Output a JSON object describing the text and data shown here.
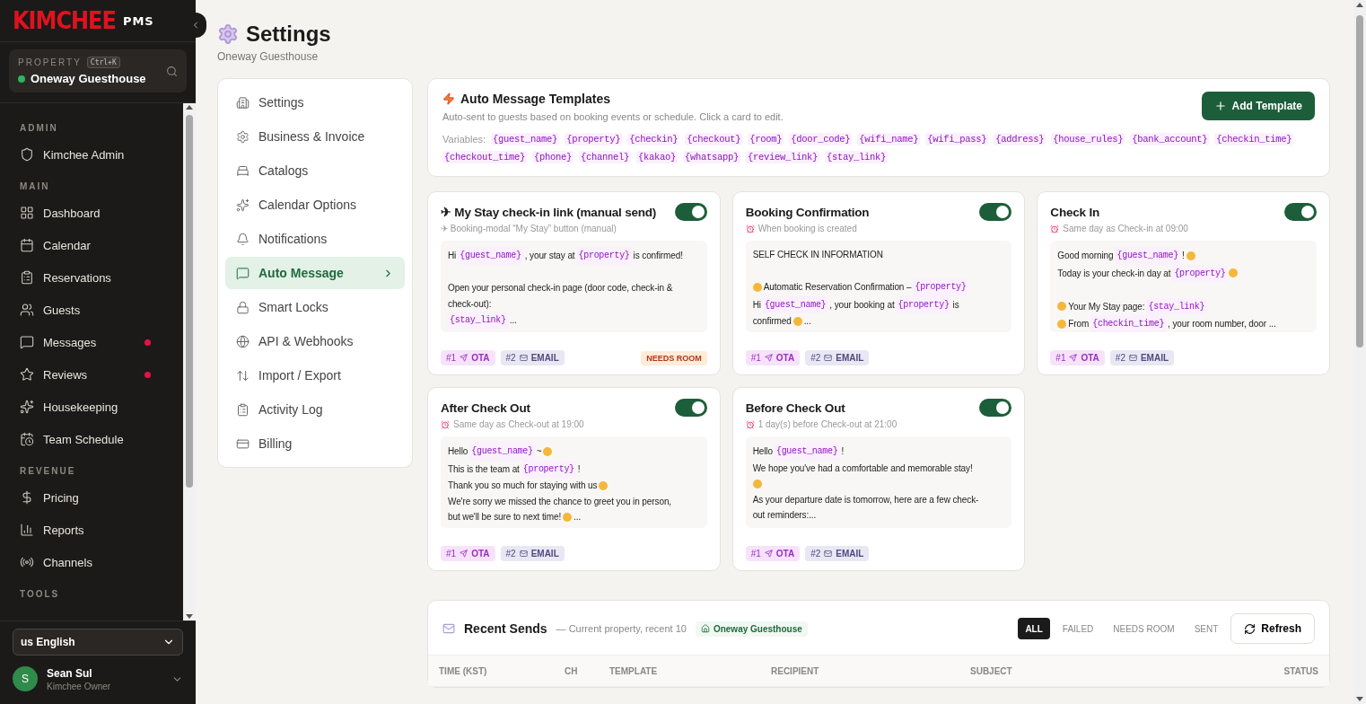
{
  "brand": {
    "name": "KIMCHEE",
    "suffix": "PMS"
  },
  "property": {
    "label": "PROPERTY",
    "shortcut": "Ctrl+K",
    "name": "Oneway Guesthouse",
    "online": true
  },
  "sidebar": {
    "sections": [
      {
        "title": "ADMIN",
        "items": [
          {
            "label": "Kimchee Admin",
            "alert": false
          }
        ]
      },
      {
        "title": "MAIN",
        "items": [
          {
            "label": "Dashboard",
            "alert": false
          },
          {
            "label": "Calendar",
            "alert": false
          },
          {
            "label": "Reservations",
            "alert": false
          },
          {
            "label": "Guests",
            "alert": false
          },
          {
            "label": "Messages",
            "alert": true
          },
          {
            "label": "Reviews",
            "alert": true
          },
          {
            "label": "Housekeeping",
            "alert": false
          },
          {
            "label": "Team Schedule",
            "alert": false
          }
        ]
      },
      {
        "title": "REVENUE",
        "items": [
          {
            "label": "Pricing",
            "alert": false
          },
          {
            "label": "Reports",
            "alert": false
          },
          {
            "label": "Channels",
            "alert": false
          }
        ]
      },
      {
        "title": "TOOLS"
      }
    ]
  },
  "language": {
    "value": "us English"
  },
  "user": {
    "initial": "S",
    "name": "Sean Sul",
    "role": "Kimchee Owner"
  },
  "page": {
    "title": "Settings",
    "subtitle": "Oneway Guesthouse"
  },
  "settings_nav": [
    {
      "label": "Settings",
      "selected": false
    },
    {
      "label": "Business & Invoice",
      "selected": false
    },
    {
      "label": "Catalogs",
      "selected": false
    },
    {
      "label": "Calendar Options",
      "selected": false
    },
    {
      "label": "Notifications",
      "selected": false
    },
    {
      "label": "Auto Message",
      "selected": true
    },
    {
      "label": "Smart Locks",
      "selected": false
    },
    {
      "label": "API & Webhooks",
      "selected": false
    },
    {
      "label": "Import / Export",
      "selected": false
    },
    {
      "label": "Activity Log",
      "selected": false
    },
    {
      "label": "Billing",
      "selected": false
    }
  ],
  "templates_header": {
    "title": "Auto Message Templates",
    "description": "Auto-sent to guests based on booking events or schedule. Click a card to edit.",
    "add_button": "Add Template",
    "variables_label": "Variables:",
    "variables": [
      "{guest_name}",
      "{property}",
      "{checkin}",
      "{checkout}",
      "{room}",
      "{door_code}",
      "{wifi_name}",
      "{wifi_pass}",
      "{address}",
      "{house_rules}",
      "{bank_account}",
      "{checkin_time}",
      "{checkout_time}",
      "{phone}",
      "{channel}",
      "{kakao}",
      "{whatsapp}",
      "{review_link}",
      "{stay_link}"
    ]
  },
  "templates": [
    {
      "title": "✈ My Stay check-in link (manual send)",
      "on": true,
      "trigger": {
        "kind": "manual",
        "text": "✈ Booking-modal “My Stay” button (manual)"
      },
      "body": [
        {
          "lines": [
            [
              {
                "kind": "text",
                "text": "Hi"
              },
              {
                "kind": "var",
                "text": "{guest_name}"
              },
              {
                "kind": "text",
                "text": ", your stay at"
              },
              {
                "kind": "var",
                "text": "{property}"
              },
              {
                "kind": "text",
                "text": "is confirmed!"
              }
            ]
          ]
        },
        {
          "lines": [
            [
              {
                "kind": "text",
                "text": "Open your personal check-in page (door code, check-in &"
              }
            ],
            [
              {
                "kind": "text",
                "text": "check-out):"
              }
            ],
            [
              {
                "kind": "var",
                "text": "{stay_link}"
              },
              {
                "kind": "text",
                "text": "..."
              }
            ]
          ]
        }
      ],
      "channels": [
        {
          "order": "#1",
          "name": "OTA",
          "kind": "ota"
        },
        {
          "order": "#2",
          "name": "EMAIL",
          "kind": "email"
        }
      ],
      "badge": "NEEDS ROOM"
    },
    {
      "title": "Booking Confirmation",
      "on": true,
      "trigger": {
        "kind": "schedule",
        "text": "When booking is created"
      },
      "body": [
        {
          "lines": [
            [
              {
                "kind": "text",
                "text": "SELF CHECK IN INFORMATION"
              }
            ]
          ]
        },
        {
          "lines": [
            [
              {
                "kind": "emoji"
              },
              {
                "kind": "text",
                "text": "Automatic Reservation Confirmation –"
              },
              {
                "kind": "var",
                "text": "{property}"
              }
            ],
            [
              {
                "kind": "text",
                "text": "Hi"
              },
              {
                "kind": "var",
                "text": "{guest_name}"
              },
              {
                "kind": "text",
                "text": ", your booking at"
              },
              {
                "kind": "var",
                "text": "{property}"
              },
              {
                "kind": "text",
                "text": "is"
              }
            ],
            [
              {
                "kind": "text",
                "text": "confirmed"
              },
              {
                "kind": "emoji"
              },
              {
                "kind": "text",
                "text": "..."
              }
            ]
          ]
        }
      ],
      "channels": [
        {
          "order": "#1",
          "name": "OTA",
          "kind": "ota"
        },
        {
          "order": "#2",
          "name": "EMAIL",
          "kind": "email"
        }
      ]
    },
    {
      "title": "Check In",
      "on": true,
      "trigger": {
        "kind": "schedule",
        "text": "Same day as Check-in at 09:00"
      },
      "body": [
        {
          "lines": [
            [
              {
                "kind": "text",
                "text": "Good morning"
              },
              {
                "kind": "var",
                "text": "{guest_name}"
              },
              {
                "kind": "text",
                "text": "!"
              },
              {
                "kind": "emoji"
              }
            ],
            [
              {
                "kind": "text",
                "text": "Today is your check-in day at"
              },
              {
                "kind": "var",
                "text": "{property}"
              },
              {
                "kind": "emoji"
              }
            ]
          ]
        },
        {
          "lines": [
            [
              {
                "kind": "emoji"
              },
              {
                "kind": "text",
                "text": "Your My Stay page:"
              },
              {
                "kind": "var",
                "text": "{stay_link}"
              }
            ],
            [
              {
                "kind": "emoji"
              },
              {
                "kind": "text",
                "text": "From"
              },
              {
                "kind": "var",
                "text": "{checkin_time}"
              },
              {
                "kind": "text",
                "text": ", your room number, door ..."
              }
            ]
          ]
        }
      ],
      "channels": [
        {
          "order": "#1",
          "name": "OTA",
          "kind": "ota"
        },
        {
          "order": "#2",
          "name": "EMAIL",
          "kind": "email"
        }
      ]
    },
    {
      "title": "After Check Out",
      "on": true,
      "trigger": {
        "kind": "schedule",
        "text": "Same day as Check-out at 19:00"
      },
      "body": [
        {
          "lines": [
            [
              {
                "kind": "text",
                "text": "Hello"
              },
              {
                "kind": "var",
                "text": "{guest_name}"
              },
              {
                "kind": "text",
                "text": "~"
              },
              {
                "kind": "emoji"
              }
            ],
            [
              {
                "kind": "text",
                "text": "This is the team at"
              },
              {
                "kind": "var",
                "text": "{property}"
              },
              {
                "kind": "text",
                "text": "!"
              }
            ],
            [
              {
                "kind": "text",
                "text": "Thank you so much for staying with us"
              },
              {
                "kind": "emoji"
              }
            ],
            [
              {
                "kind": "text",
                "text": "We're sorry we missed the chance to greet you in person,"
              }
            ],
            [
              {
                "kind": "text",
                "text": "but we'll be sure to next time!"
              },
              {
                "kind": "emoji"
              },
              {
                "kind": "text",
                "text": "..."
              }
            ]
          ]
        }
      ],
      "channels": [
        {
          "order": "#1",
          "name": "OTA",
          "kind": "ota"
        },
        {
          "order": "#2",
          "name": "EMAIL",
          "kind": "email"
        }
      ]
    },
    {
      "title": "Before Check Out",
      "on": true,
      "trigger": {
        "kind": "schedule",
        "text": "1 day(s) before Check-out at 21:00"
      },
      "body": [
        {
          "lines": [
            [
              {
                "kind": "text",
                "text": "Hello"
              },
              {
                "kind": "var",
                "text": "{guest_name}"
              },
              {
                "kind": "text",
                "text": "!"
              }
            ],
            [
              {
                "kind": "text",
                "text": "We hope you've had a comfortable and memorable stay!"
              }
            ],
            [
              {
                "kind": "emoji"
              }
            ],
            [
              {
                "kind": "text",
                "text": "As your departure date is tomorrow, here are a few check-"
              }
            ],
            [
              {
                "kind": "text",
                "text": "out reminders:..."
              }
            ]
          ]
        }
      ],
      "channels": [
        {
          "order": "#1",
          "name": "OTA",
          "kind": "ota"
        },
        {
          "order": "#2",
          "name": "EMAIL",
          "kind": "email"
        }
      ]
    }
  ],
  "recent_sends": {
    "title": "Recent Sends",
    "note": "— Current property, recent 10",
    "property": "Oneway Guesthouse",
    "filters": [
      {
        "label": "ALL",
        "selected": true
      },
      {
        "label": "FAILED",
        "selected": false
      },
      {
        "label": "NEEDS ROOM",
        "selected": false
      },
      {
        "label": "SENT",
        "selected": false
      }
    ],
    "refresh_button": "Refresh",
    "columns": [
      "TIME (KST)",
      "CH",
      "TEMPLATE",
      "RECIPIENT",
      "SUBJECT",
      "STATUS"
    ]
  }
}
